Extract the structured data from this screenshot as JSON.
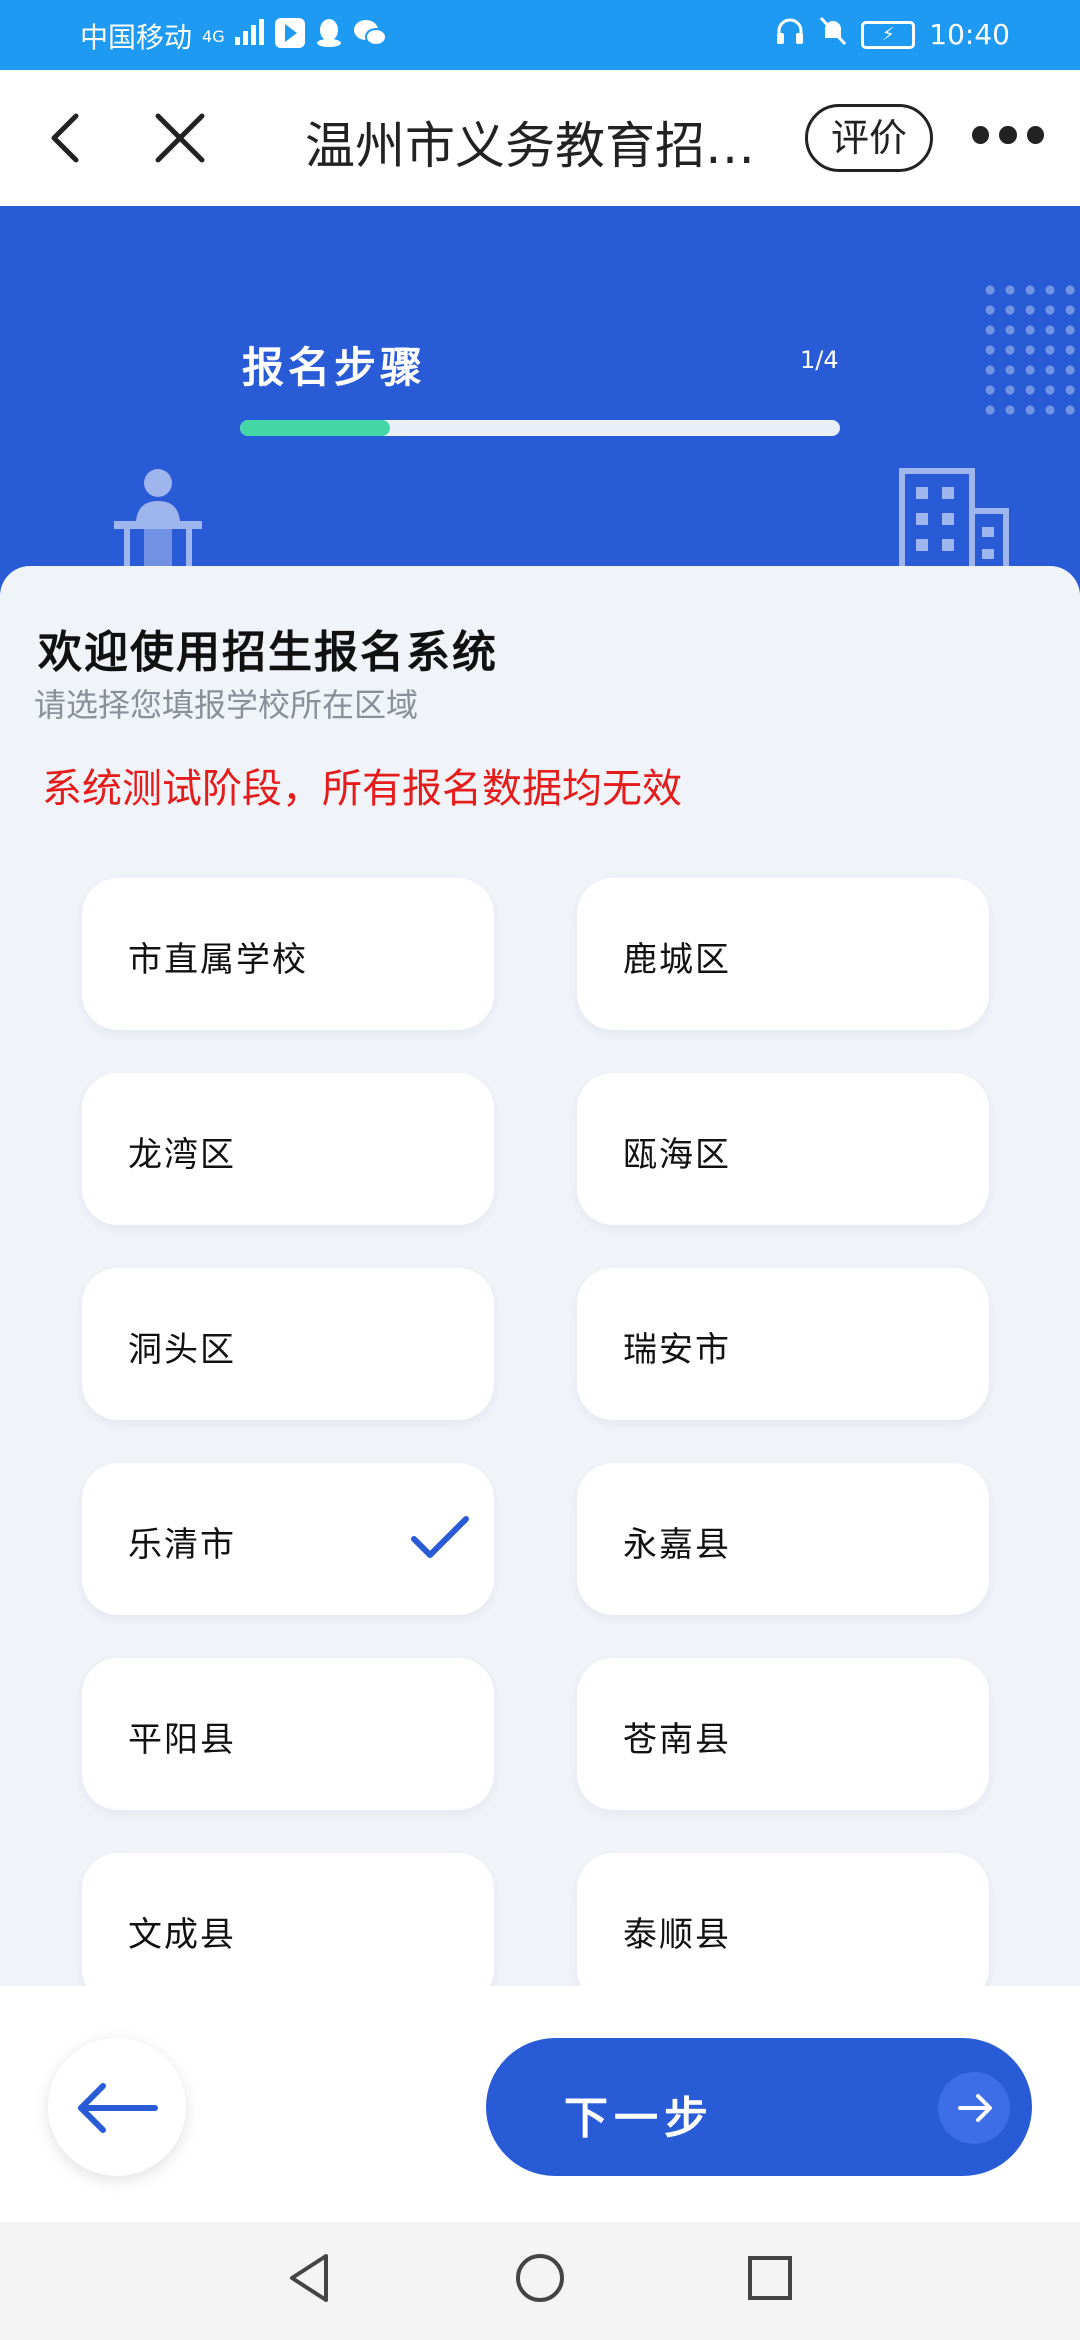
{
  "status_bar": {
    "carrier": "中国移动",
    "network": "4G",
    "time": "10:40",
    "icons": [
      "signal-icon",
      "app-notification-icon",
      "qq-icon",
      "wechat-icon",
      "headphones-icon",
      "mute-icon",
      "battery-icon"
    ]
  },
  "header": {
    "title": "温州市义务教育招…",
    "rate_label": "评价",
    "icons": [
      "back-icon",
      "close-icon",
      "more-icon"
    ]
  },
  "hero": {
    "step_title": "报名步骤",
    "step_count": "1/4",
    "progress": 0.25,
    "colors": {
      "background": "#2A5BD7",
      "progress_fill": "#45D6A5",
      "progress_track": "#E9EEF7"
    }
  },
  "main": {
    "welcome_title": "欢迎使用招生报名系统",
    "subtitle": "请选择您填报学校所在区域",
    "notice": "系统测试阶段，所有报名数据均无效",
    "notice_color": "#E51C1C",
    "regions": [
      {
        "label": "市直属学校",
        "selected": false
      },
      {
        "label": "鹿城区",
        "selected": false
      },
      {
        "label": "龙湾区",
        "selected": false
      },
      {
        "label": "瓯海区",
        "selected": false
      },
      {
        "label": "洞头区",
        "selected": false
      },
      {
        "label": "瑞安市",
        "selected": false
      },
      {
        "label": "乐清市",
        "selected": true
      },
      {
        "label": "永嘉县",
        "selected": false
      },
      {
        "label": "平阳县",
        "selected": false
      },
      {
        "label": "苍南县",
        "selected": false
      },
      {
        "label": "文成县",
        "selected": false
      },
      {
        "label": "泰顺县",
        "selected": false
      }
    ]
  },
  "bottom_bar": {
    "next_label": "下一步",
    "icons": [
      "arrow-left-icon",
      "arrow-right-icon"
    ],
    "accent": "#2A5BD7"
  },
  "system_nav": {
    "icons": [
      "nav-back-icon",
      "nav-home-icon",
      "nav-recent-icon"
    ]
  }
}
